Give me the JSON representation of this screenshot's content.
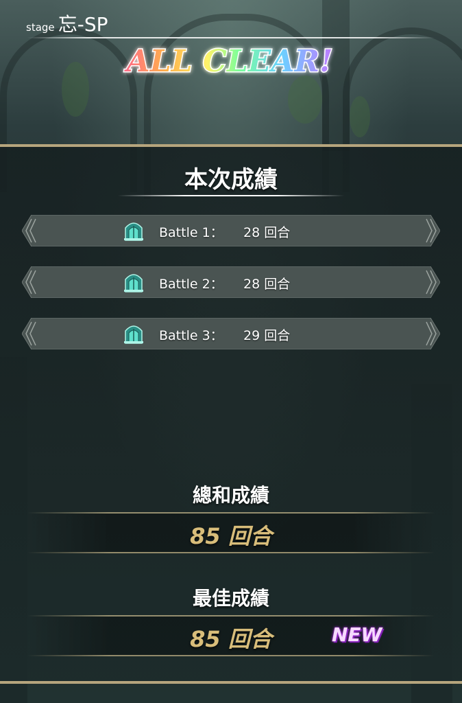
{
  "header": {
    "stage_prefix": "stage",
    "stage_name": "忘-SP",
    "banner_text": "ALL CLEAR!"
  },
  "current_results": {
    "title": "本次成績",
    "battles": [
      {
        "label": "Battle 1：",
        "value": "28 回合",
        "icon": "gate-icon"
      },
      {
        "label": "Battle 2：",
        "value": "28 回合",
        "icon": "gate-icon"
      },
      {
        "label": "Battle 3：",
        "value": "29 回合",
        "icon": "gate-icon"
      }
    ]
  },
  "total": {
    "title": "總和成績",
    "value": "85 回合"
  },
  "best": {
    "title": "最佳成績",
    "value": "85 回合",
    "badge": "NEW"
  },
  "colors": {
    "accent_gold": "#b6a57d",
    "score_gold": "#d8bd7a",
    "badge_purple": "#9b2cc9",
    "gate_teal": "#3fc7b4"
  }
}
